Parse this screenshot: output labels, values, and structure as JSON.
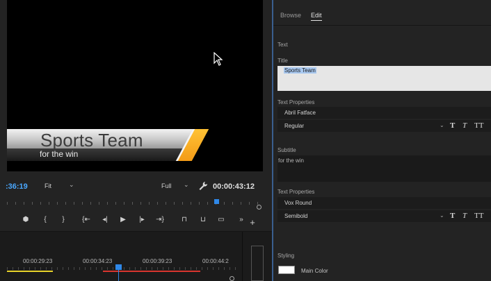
{
  "monitor": {
    "lower_third_title": "Sports Team",
    "lower_third_subtitle": "for the win",
    "timecode_left": ":36:19",
    "fit_label": "Fit",
    "resolution_label": "Full",
    "timecode_right": "00:00:43:12"
  },
  "transport": {
    "buttons": [
      "marker-icon",
      "mark-in-icon",
      "mark-out-icon",
      "go-to-in-icon",
      "step-back-icon",
      "play-icon",
      "step-forward-icon",
      "go-to-out-icon",
      "lift-icon",
      "extract-icon",
      "export-frame-icon",
      "more-icon",
      "add-button-icon"
    ],
    "glyphs": [
      "⬢",
      "{",
      "}",
      "{⇤",
      "◂|",
      "▶",
      "|▸",
      "⇥}",
      "⊓",
      "⊔",
      "▭",
      "»",
      "+"
    ]
  },
  "timeline": {
    "times": [
      "00:00:29:23",
      "00:00:34:23",
      "00:00:39:23",
      "00:00:44:2"
    ]
  },
  "panel": {
    "tabs": [
      "Browse",
      "Edit"
    ],
    "active_tab": "Edit",
    "section_text": "Text",
    "title_label": "Title",
    "title_value": "Sports Team",
    "text_properties_label": "Text Properties",
    "title_font": "Abril Fatface",
    "title_style": "Regular",
    "subtitle_label": "Subtitle",
    "subtitle_value": "for the win",
    "subtitle_font": "Vox Round",
    "subtitle_style": "Semibold",
    "styling_label": "Styling",
    "main_color_label": "Main Color",
    "main_color": "#ffffff",
    "text_style_glyphs": [
      "T",
      "T",
      "TT"
    ]
  },
  "colors": {
    "accent": "#2f88e8",
    "timecode_blue": "#4aa8ff",
    "panel_bg": "#232323"
  }
}
